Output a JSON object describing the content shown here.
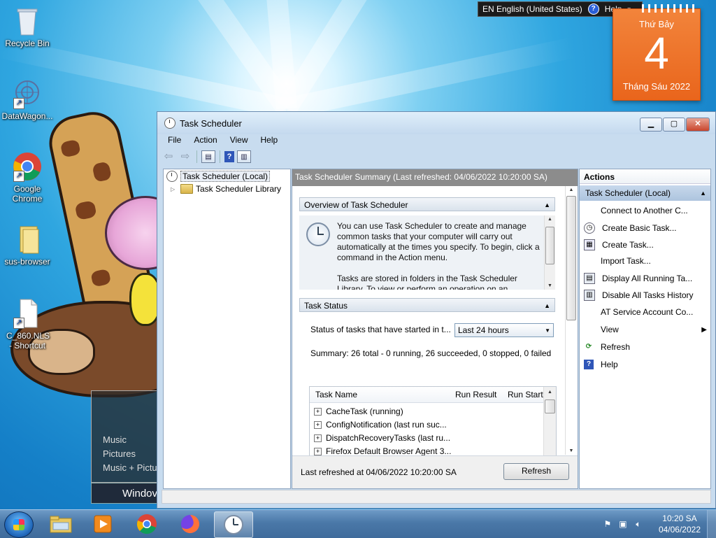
{
  "desktop": {
    "icons": [
      {
        "label": "Recycle Bin",
        "icon": "recycle-bin-icon"
      },
      {
        "label": "DataWagon...",
        "icon": "datawagon-shortcut-icon"
      },
      {
        "label": "Google Chrome",
        "icon": "chrome-icon"
      },
      {
        "label": "sus-browser",
        "icon": "folder-icon"
      },
      {
        "label": "C_860.NLS - Shortcut",
        "icon": "file-shortcut-icon"
      }
    ],
    "media_gadget": [
      "Music",
      "Pictures",
      "Music + Pictu"
    ],
    "media_bar_label": "Windov"
  },
  "langbar": {
    "language": "EN English (United States)",
    "help": "Help"
  },
  "calendar": {
    "weekday": "Thứ Bảy",
    "day": "4",
    "month": "Tháng Sáu 2022"
  },
  "window": {
    "title": "Task Scheduler",
    "menu": [
      "File",
      "Action",
      "View",
      "Help"
    ],
    "tree": {
      "root": "Task Scheduler (Local)",
      "child": "Task Scheduler Library"
    },
    "center": {
      "header": "Task Scheduler Summary (Last refreshed: 04/06/2022 10:20:00 SA)",
      "overview_title": "Overview of Task Scheduler",
      "overview_text_1": "You can use Task Scheduler to create and manage common tasks that your computer will carry out automatically at the times you specify. To begin, click a command in the Action menu.",
      "overview_text_2": "Tasks are stored in folders in the Task Scheduler Library. To view or perform an operation on an",
      "status_title": "Task Status",
      "status_label": "Status of tasks that have started in t...",
      "status_select": "Last 24 hours",
      "summary": "Summary: 26 total - 0 running, 26 succeeded, 0 stopped, 0 failed",
      "columns": [
        "Task Name",
        "Run Result",
        "Run Start"
      ],
      "rows": [
        "CacheTask (running)",
        "ConfigNotification (last run suc...",
        "DispatchRecoveryTasks (last ru...",
        "Firefox Default Browser Agent 3..."
      ],
      "footer": "Last refreshed at 04/06/2022 10:20:00 SA",
      "refresh_button": "Refresh"
    },
    "actions": {
      "title": "Actions",
      "group": "Task Scheduler (Local)",
      "items": [
        {
          "label": "Connect to Another C...",
          "icon": ""
        },
        {
          "label": "Create Basic Task...",
          "icon": "create-basic-task-icon"
        },
        {
          "label": "Create Task...",
          "icon": "create-task-icon"
        },
        {
          "label": "Import Task...",
          "icon": ""
        },
        {
          "label": "Display All Running Ta...",
          "icon": "display-running-icon"
        },
        {
          "label": "Disable All Tasks History",
          "icon": "disable-history-icon"
        },
        {
          "label": "AT Service Account Co...",
          "icon": ""
        },
        {
          "label": "View",
          "icon": ""
        },
        {
          "label": "Refresh",
          "icon": "refresh-icon"
        },
        {
          "label": "Help",
          "icon": "help-icon"
        }
      ]
    }
  },
  "taskbar": {
    "apps": [
      "explorer-icon",
      "media-player-icon",
      "chrome-icon",
      "firefox-icon",
      "task-scheduler-icon"
    ],
    "time": "10:20 SA",
    "date": "04/06/2022"
  },
  "colors": {
    "accent": "#1580c8",
    "calendar": "#e9651c",
    "selection": "#adc4de"
  }
}
